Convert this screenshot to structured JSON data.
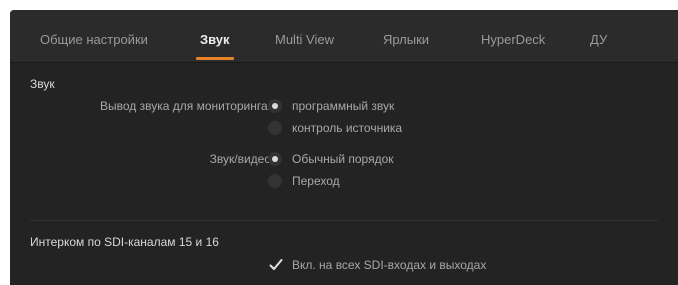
{
  "tabs": [
    {
      "label": "Общие настройки",
      "active": false
    },
    {
      "label": "Звук",
      "active": true
    },
    {
      "label": "Multi View",
      "active": false
    },
    {
      "label": "Ярлыки",
      "active": false
    },
    {
      "label": "HyperDeck",
      "active": false
    },
    {
      "label": "ДУ",
      "active": false
    }
  ],
  "accent_color": "#e8832a",
  "audio": {
    "title": "Звук",
    "monitor_output": {
      "label": "Вывод звука для мониторинга:",
      "options": [
        {
          "label": "программный звук",
          "selected": true
        },
        {
          "label": "контроль источника",
          "selected": false
        }
      ]
    },
    "audio_video": {
      "label": "Звук/видео",
      "options": [
        {
          "label": "Обычный порядок",
          "selected": true
        },
        {
          "label": "Переход",
          "selected": false
        }
      ]
    }
  },
  "intercom": {
    "title": "Интерком по SDI-каналам 15 и 16",
    "checkbox": {
      "label": "Вкл. на всех SDI-входах и выходах",
      "checked": true
    }
  }
}
